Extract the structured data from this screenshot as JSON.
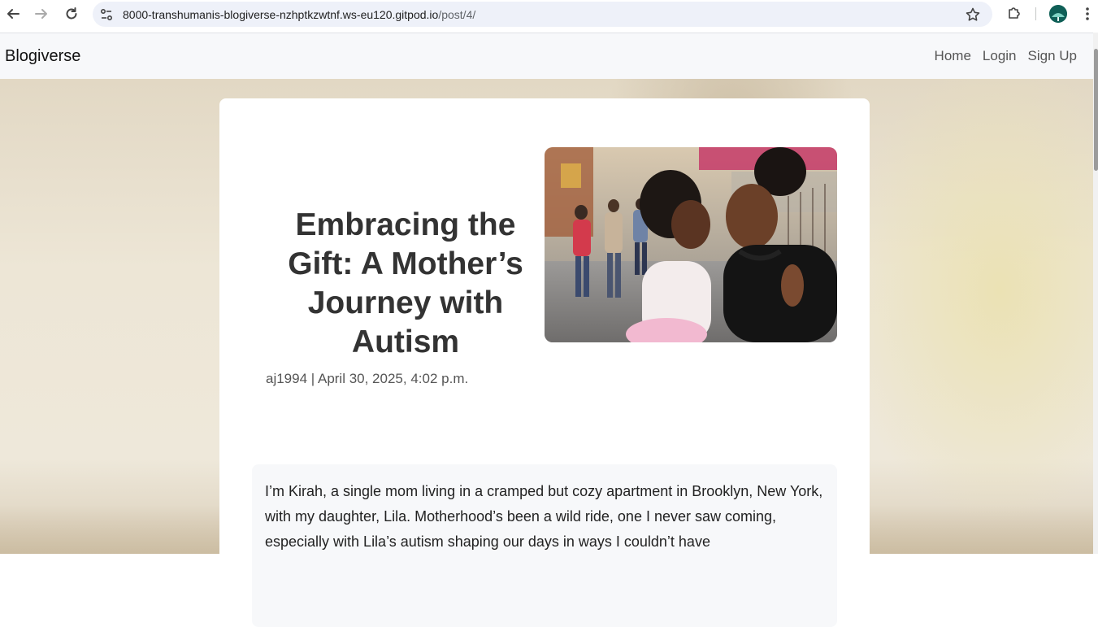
{
  "browser": {
    "url_host": "8000-transhumanis-blogiverse-nzhptkzwtnf.ws-eu120.gitpod.io",
    "url_path": "/post/4/"
  },
  "nav": {
    "brand": "Blogiverse",
    "links": [
      "Home",
      "Login",
      "Sign Up"
    ]
  },
  "post": {
    "title": "Embracing the Gift: A Mother’s Journey with Autism",
    "meta": "aj1994 | April 30, 2025, 4:02 p.m.",
    "excerpt": "I’m Kirah, a single mom living in a cramped but cozy apartment in Brooklyn, New York, with my daughter, Lila. Motherhood’s been a wild ride, one I never saw coming, especially with Lila’s autism shaping our days in ways I couldn’t have"
  },
  "icons": {
    "back": "back-arrow-icon",
    "forward": "forward-arrow-icon",
    "reload": "reload-icon",
    "site_info": "site-info-icon",
    "bookmark": "star-icon",
    "extensions": "puzzle-icon",
    "profile": "profile-avatar-icon",
    "menu": "kebab-menu-icon"
  }
}
